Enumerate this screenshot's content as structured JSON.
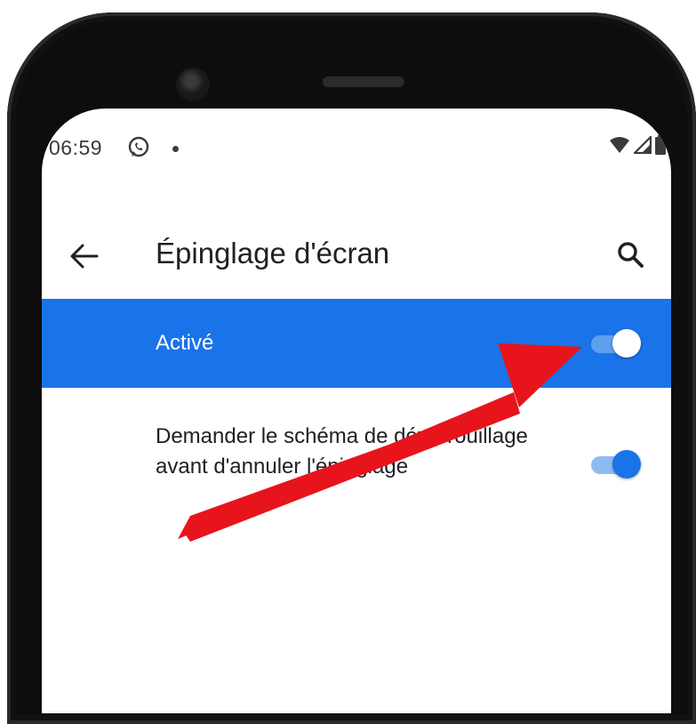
{
  "status_bar": {
    "time": "06:59",
    "icons": [
      "whatsapp-icon",
      "notification-dot",
      "wifi-icon",
      "signal-icon",
      "battery-icon"
    ]
  },
  "toolbar": {
    "title": "Épinglage d'écran",
    "icons": [
      "arrow-back-icon",
      "search-icon"
    ]
  },
  "master_switch": {
    "label": "Activé",
    "state": "on"
  },
  "settings": [
    {
      "label": "Demander le schéma de déverrouillage avant d'annuler l'épinglage",
      "state": "on"
    }
  ],
  "annotation": {
    "type": "red-arrow",
    "points_to": "master-switch"
  },
  "colors": {
    "accent": "#1a73e8",
    "switch_track_on": "#8fbbf4",
    "annotation_red": "#e8141b",
    "phone_frame": "#0d0d0d"
  }
}
